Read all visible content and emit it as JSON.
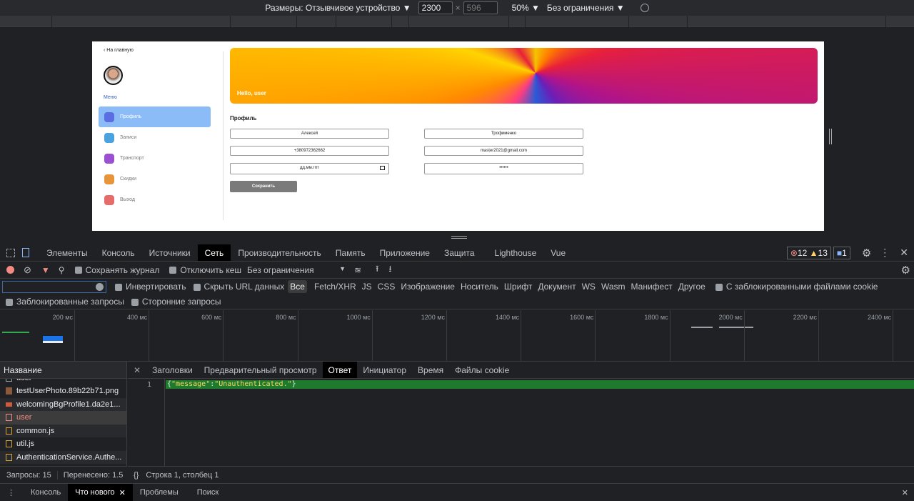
{
  "device_toolbar": {
    "dimensions_label": "Размеры: Отзывчивое устройство ▼",
    "width": "2300",
    "x": "×",
    "height": "596",
    "zoom": "50% ▼",
    "throttle": "Без ограничения ▼"
  },
  "page": {
    "back": "На главную",
    "menu_label": "Меню",
    "menu": [
      {
        "label": "Профиль",
        "color": "#5b6ee1"
      },
      {
        "label": "Записи",
        "color": "#4aa3df"
      },
      {
        "label": "Транспорт",
        "color": "#9b4fd1"
      },
      {
        "label": "Скидки",
        "color": "#e8953a"
      },
      {
        "label": "Выход",
        "color": "#e86b6b"
      }
    ],
    "greeting": "Hello, user",
    "section_title": "Профиль",
    "first_name": "Алексей",
    "last_name": "Трофименко",
    "phone": "+380972362662",
    "email": "master2021@gmail.com",
    "date_placeholder": "дд.мм.гггг",
    "password": "••••••",
    "save": "Сохранить"
  },
  "devtools": {
    "tabs": [
      "Элементы",
      "Консоль",
      "Источники",
      "Сеть",
      "Производительность",
      "Память",
      "Приложение",
      "Защита",
      "Lighthouse",
      "Vue"
    ],
    "active_tab": "Сеть",
    "errors": "12",
    "warnings": "13",
    "messages": "1",
    "toolbar": {
      "preserve_log": "Сохранять журнал",
      "disable_cache": "Отключить кеш",
      "throttle": "Без ограничения"
    },
    "filter": {
      "invert": "Инвертировать",
      "hide_data": "Скрыть URL данных",
      "types": [
        "Все",
        "Fetch/XHR",
        "JS",
        "CSS",
        "Изображение",
        "Носитель",
        "Шрифт",
        "Документ",
        "WS",
        "Wasm",
        "Манифест",
        "Другое"
      ],
      "blocked_cookies": "С заблокированными файлами cookie",
      "blocked_requests": "Заблокированные запросы",
      "third_party": "Сторонние запросы"
    },
    "timeline_ticks": [
      "200 мс",
      "400 мс",
      "600 мс",
      "800 мс",
      "1000 мс",
      "1200 мс",
      "1400 мс",
      "1600 мс",
      "1800 мс",
      "2000 мс",
      "2200 мс",
      "2400 мс"
    ],
    "list_header": "Название",
    "requests": [
      {
        "name": "user"
      },
      {
        "name": "testUserPhoto.89b22b71.png"
      },
      {
        "name": "welcomingBgProfile1.da2e1..."
      },
      {
        "name": "user",
        "error": true
      },
      {
        "name": "common.js"
      },
      {
        "name": "util.js"
      },
      {
        "name": "AuthenticationService.Authe..."
      }
    ],
    "detail_tabs": [
      "Заголовки",
      "Предварительный просмотр",
      "Ответ",
      "Инициатор",
      "Время",
      "Файлы cookie"
    ],
    "active_detail": "Ответ",
    "response_line": "1",
    "response_key": "\"message\"",
    "response_value": "\"Unauthenticated.\"",
    "summary_requests": "Запросы: 15",
    "summary_transferred": "Перенесено: 1.5",
    "status_pos": "Строка 1, столбец 1",
    "drawer_tabs": [
      "Консоль",
      "Что нового",
      "Проблемы",
      "Поиск"
    ],
    "active_drawer": "Что нового"
  }
}
